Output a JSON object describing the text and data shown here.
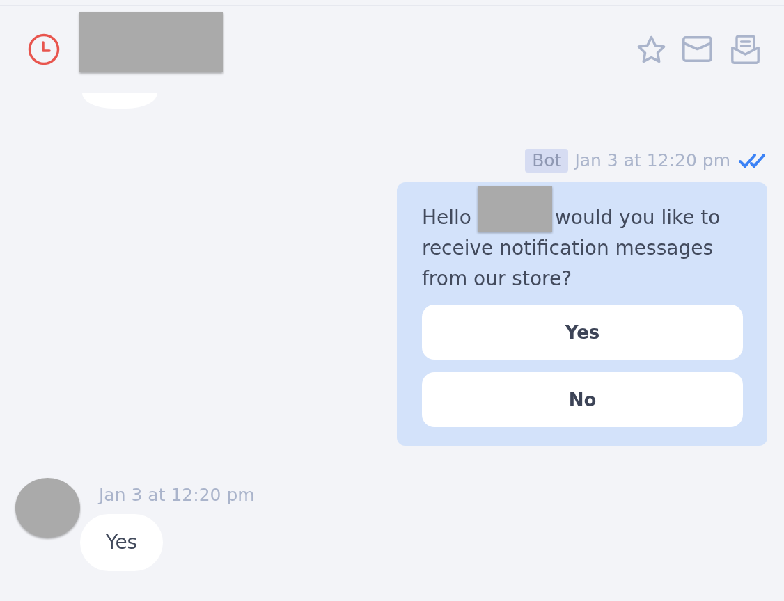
{
  "header": {
    "name_redacted": true
  },
  "messages": [
    {
      "kind": "cut_off"
    },
    {
      "kind": "outgoing",
      "sender": "Bot",
      "time": "Jan 3 at 12:20 pm",
      "read": true,
      "greeting": "Hello",
      "name_redacted": true,
      "text": "would you like to receive notification messages from our store?",
      "buttons": [
        "Yes",
        "No"
      ]
    },
    {
      "kind": "incoming",
      "time": "Jan 3 at 12:20 pm",
      "text": "Yes"
    }
  ]
}
